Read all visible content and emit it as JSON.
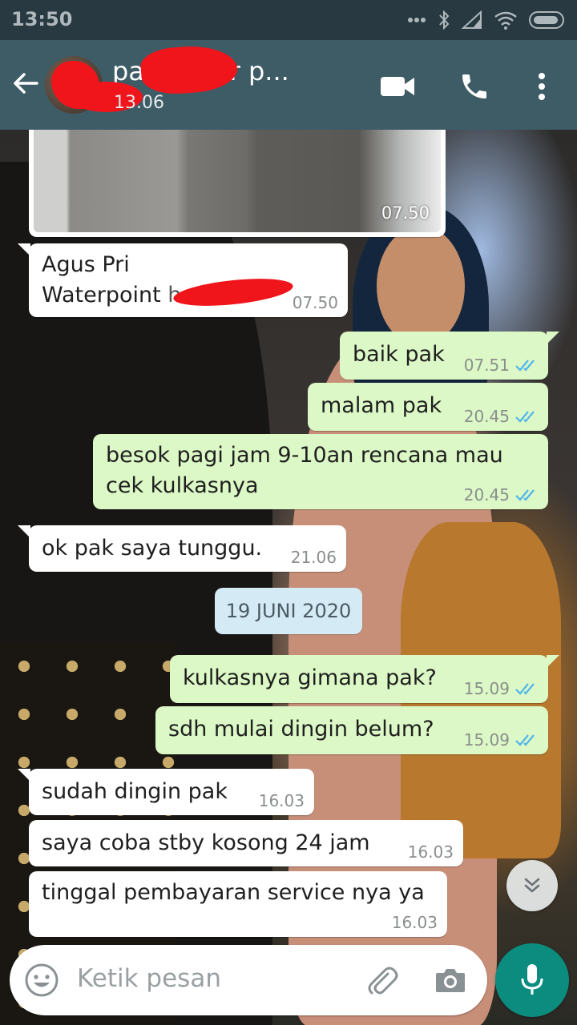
{
  "status_bar": {
    "time": "13:50"
  },
  "header": {
    "contact_name": "pak water p...",
    "last_seen": "13.06"
  },
  "colors": {
    "header": "#3e5c66",
    "status_bar": "#283941",
    "outgoing": "#dcf8c6",
    "incoming": "#ffffff",
    "accent": "#0b8c7e",
    "read_ticks": "#4fb6ec"
  },
  "icons": [
    "back-arrow-icon",
    "video-call-icon",
    "phone-icon",
    "more-vert-icon",
    "emoji-icon",
    "attach-icon",
    "camera-icon",
    "mic-icon",
    "chevrons-down-icon"
  ],
  "image_message": {
    "time": "07.50"
  },
  "messages": [
    {
      "dir": "in",
      "line1": "Agus Pri",
      "line2": "Waterpoint",
      "line2_suffix": "ho 30",
      "time": "07.50"
    },
    {
      "dir": "out",
      "text": "baik pak",
      "time": "07.51"
    },
    {
      "dir": "out",
      "text": "malam pak",
      "time": "20.45"
    },
    {
      "dir": "out",
      "line1": "besok pagi jam 9-10an rencana mau",
      "line2": "cek kulkasnya",
      "time": "20.45"
    },
    {
      "dir": "in",
      "text": "ok pak saya tunggu.",
      "time": "21.06"
    },
    {
      "dir": "out",
      "text": "kulkasnya gimana pak?",
      "time": "15.09"
    },
    {
      "dir": "out",
      "text": "sdh mulai dingin belum?",
      "time": "15.09"
    },
    {
      "dir": "in",
      "text": "sudah dingin pak",
      "time": "16.03"
    },
    {
      "dir": "in",
      "text": "saya coba stby kosong 24 jam",
      "time": "16.03"
    },
    {
      "dir": "in",
      "text": "tinggal pembayaran service nya ya",
      "time": "16.03"
    }
  ],
  "date_separator": "19 JUNI 2020",
  "composer": {
    "placeholder": "Ketik pesan"
  }
}
